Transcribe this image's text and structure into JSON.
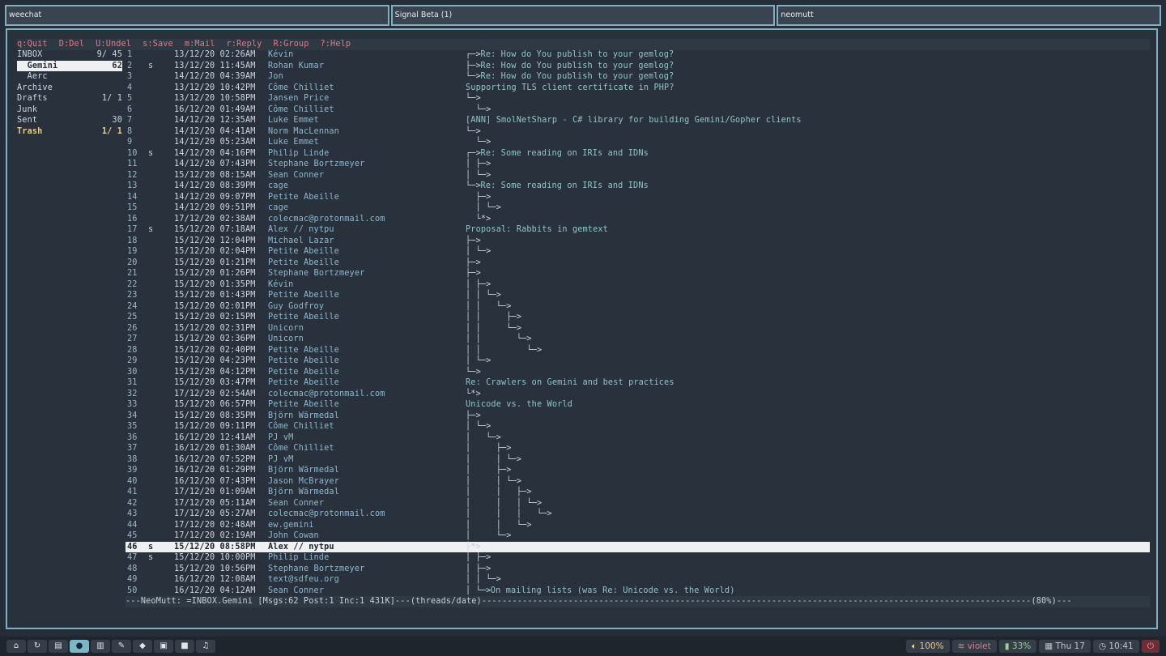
{
  "workspaces": [
    "weechat",
    "Signal Beta (1)",
    "neomutt"
  ],
  "help": [
    "q:Quit",
    "D:Del",
    "U:Undel",
    "s:Save",
    "m:Mail",
    "r:Reply",
    "R:Group",
    "?:Help"
  ],
  "sidebar": [
    {
      "name": "INBOX",
      "count": "9/ 45",
      "state": ""
    },
    {
      "name": "  Gemini",
      "count": "62",
      "state": "sel"
    },
    {
      "name": "  Aerc",
      "count": "",
      "state": ""
    },
    {
      "name": "Archive",
      "count": "",
      "state": ""
    },
    {
      "name": "Drafts",
      "count": "1/ 1",
      "state": ""
    },
    {
      "name": "Junk",
      "count": "",
      "state": ""
    },
    {
      "name": "Sent",
      "count": "30",
      "state": ""
    },
    {
      "name": "Trash",
      "count": "1/ 1",
      "state": "trash"
    }
  ],
  "messages": [
    {
      "num": "1",
      "flag": "",
      "date": "13/12/20 02:26AM",
      "from": "Kévin",
      "tree": "┌─>",
      "subject": "Re: How do You publish to your gemlog?"
    },
    {
      "num": "2",
      "flag": "s",
      "date": "13/12/20 11:45AM",
      "from": "Rohan Kumar",
      "tree": "├─>",
      "subject": "Re: How do You publish to your gemlog?"
    },
    {
      "num": "3",
      "flag": "",
      "date": "14/12/20 04:39AM",
      "from": "Jon",
      "tree": "└─>",
      "subject": "Re: How do You publish to your gemlog?"
    },
    {
      "num": "4",
      "flag": "",
      "date": "13/12/20 10:42PM",
      "from": "Côme Chilliet",
      "tree": "",
      "subject": "Supporting TLS client certificate in PHP?"
    },
    {
      "num": "5",
      "flag": "",
      "date": "13/12/20 10:58PM",
      "from": "Jansen Price",
      "tree": "└─>",
      "subject": ""
    },
    {
      "num": "6",
      "flag": "",
      "date": "16/12/20 01:49AM",
      "from": "Côme Chilliet",
      "tree": "  └─>",
      "subject": ""
    },
    {
      "num": "7",
      "flag": "",
      "date": "14/12/20 12:35AM",
      "from": "Luke Emmet",
      "tree": "",
      "subject": "[ANN] SmolNetSharp - C# library for building Gemini/Gopher clients"
    },
    {
      "num": "8",
      "flag": "",
      "date": "14/12/20 04:41AM",
      "from": "Norm MacLennan",
      "tree": "└─>",
      "subject": ""
    },
    {
      "num": "9",
      "flag": "",
      "date": "14/12/20 05:23AM",
      "from": "Luke Emmet",
      "tree": "  └─>",
      "subject": ""
    },
    {
      "num": "10",
      "flag": "s",
      "date": "14/12/20 04:16PM",
      "from": "Philip Linde",
      "tree": "┌─>",
      "subject": "Re: Some reading on IRIs and IDNs"
    },
    {
      "num": "11",
      "flag": "",
      "date": "14/12/20 07:43PM",
      "from": "Stephane Bortzmeyer",
      "tree": "│ ├─>",
      "subject": ""
    },
    {
      "num": "12",
      "flag": "",
      "date": "15/12/20 08:15AM",
      "from": "Sean Conner",
      "tree": "│ └─>",
      "subject": ""
    },
    {
      "num": "13",
      "flag": "",
      "date": "14/12/20 08:39PM",
      "from": "cage",
      "tree": "└─>",
      "subject": "Re: Some reading on IRIs and IDNs"
    },
    {
      "num": "14",
      "flag": "",
      "date": "14/12/20 09:07PM",
      "from": "Petite Abeille",
      "tree": "  ├─>",
      "subject": ""
    },
    {
      "num": "15",
      "flag": "",
      "date": "14/12/20 09:51PM",
      "from": "cage",
      "tree": "  │ └─>",
      "subject": ""
    },
    {
      "num": "16",
      "flag": "",
      "date": "17/12/20 02:38AM",
      "from": "colecmac@protonmail.com",
      "tree": "  └*>",
      "subject": ""
    },
    {
      "num": "17",
      "flag": "s",
      "date": "15/12/20 07:18AM",
      "from": "Alex // nytpu",
      "tree": "",
      "subject": "Proposal: Rabbits in gemtext"
    },
    {
      "num": "18",
      "flag": "",
      "date": "15/12/20 12:04PM",
      "from": "Michael Lazar",
      "tree": "├─>",
      "subject": ""
    },
    {
      "num": "19",
      "flag": "",
      "date": "15/12/20 02:04PM",
      "from": "Petite Abeille",
      "tree": "│ └─>",
      "subject": ""
    },
    {
      "num": "20",
      "flag": "",
      "date": "15/12/20 01:21PM",
      "from": "Petite Abeille",
      "tree": "├─>",
      "subject": ""
    },
    {
      "num": "21",
      "flag": "",
      "date": "15/12/20 01:26PM",
      "from": "Stephane Bortzmeyer",
      "tree": "├─>",
      "subject": ""
    },
    {
      "num": "22",
      "flag": "",
      "date": "15/12/20 01:35PM",
      "from": "Kévin",
      "tree": "│ ├─>",
      "subject": ""
    },
    {
      "num": "23",
      "flag": "",
      "date": "15/12/20 01:43PM",
      "from": "Petite Abeille",
      "tree": "│ │ └─>",
      "subject": ""
    },
    {
      "num": "24",
      "flag": "",
      "date": "15/12/20 02:01PM",
      "from": "Guy Godfroy",
      "tree": "│ │   └─>",
      "subject": ""
    },
    {
      "num": "25",
      "flag": "",
      "date": "15/12/20 02:15PM",
      "from": "Petite Abeille",
      "tree": "│ │     ├─>",
      "subject": ""
    },
    {
      "num": "26",
      "flag": "",
      "date": "15/12/20 02:31PM",
      "from": "Unicorn",
      "tree": "│ │     └─>",
      "subject": ""
    },
    {
      "num": "27",
      "flag": "",
      "date": "15/12/20 02:36PM",
      "from": "Unicorn",
      "tree": "│ │       └─>",
      "subject": ""
    },
    {
      "num": "28",
      "flag": "",
      "date": "15/12/20 02:40PM",
      "from": "Petite Abeille",
      "tree": "│ │         └─>",
      "subject": ""
    },
    {
      "num": "29",
      "flag": "",
      "date": "15/12/20 04:23PM",
      "from": "Petite Abeille",
      "tree": "│ └─>",
      "subject": ""
    },
    {
      "num": "30",
      "flag": "",
      "date": "15/12/20 04:12PM",
      "from": "Petite Abeille",
      "tree": "└─>",
      "subject": ""
    },
    {
      "num": "31",
      "flag": "",
      "date": "15/12/20 03:47PM",
      "from": "Petite Abeille",
      "tree": "",
      "subject": "Re: Crawlers on Gemini and best practices"
    },
    {
      "num": "32",
      "flag": "",
      "date": "17/12/20 02:54AM",
      "from": "colecmac@protonmail.com",
      "tree": "└*>",
      "subject": ""
    },
    {
      "num": "33",
      "flag": "",
      "date": "15/12/20 06:57PM",
      "from": "Petite Abeille",
      "tree": "",
      "subject": "Unicode vs. the World"
    },
    {
      "num": "34",
      "flag": "",
      "date": "15/12/20 08:35PM",
      "from": "Björn Wärmedal",
      "tree": "├─>",
      "subject": ""
    },
    {
      "num": "35",
      "flag": "",
      "date": "15/12/20 09:11PM",
      "from": "Côme Chilliet",
      "tree": "│ └─>",
      "subject": ""
    },
    {
      "num": "36",
      "flag": "",
      "date": "16/12/20 12:41AM",
      "from": "PJ vM",
      "tree": "│   └─>",
      "subject": ""
    },
    {
      "num": "37",
      "flag": "",
      "date": "16/12/20 01:30AM",
      "from": "Côme Chilliet",
      "tree": "│     ├─>",
      "subject": ""
    },
    {
      "num": "38",
      "flag": "",
      "date": "16/12/20 07:52PM",
      "from": "PJ vM",
      "tree": "│     │ └─>",
      "subject": ""
    },
    {
      "num": "39",
      "flag": "",
      "date": "16/12/20 01:29PM",
      "from": "Björn Wärmedal",
      "tree": "│     ├─>",
      "subject": ""
    },
    {
      "num": "40",
      "flag": "",
      "date": "16/12/20 07:43PM",
      "from": "Jason McBrayer",
      "tree": "│     │ └─>",
      "subject": ""
    },
    {
      "num": "41",
      "flag": "",
      "date": "17/12/20 01:09AM",
      "from": "Björn Wärmedal",
      "tree": "│     │   ├─>",
      "subject": ""
    },
    {
      "num": "42",
      "flag": "",
      "date": "17/12/20 05:11AM",
      "from": "Sean Conner",
      "tree": "│     │   │ └─>",
      "subject": ""
    },
    {
      "num": "43",
      "flag": "",
      "date": "17/12/20 05:27AM",
      "from": "colecmac@protonmail.com",
      "tree": "│     │   │   └─>",
      "subject": ""
    },
    {
      "num": "44",
      "flag": "",
      "date": "17/12/20 02:48AM",
      "from": "ew.gemini",
      "tree": "│     │   └─>",
      "subject": ""
    },
    {
      "num": "45",
      "flag": "",
      "date": "17/12/20 02:19AM",
      "from": "John Cowan",
      "tree": "│     └─>",
      "subject": ""
    },
    {
      "num": "46",
      "flag": "s",
      "date": "15/12/20 08:58PM",
      "from": "Alex // nytpu",
      "tree": "├*>",
      "subject": "",
      "selected": true
    },
    {
      "num": "47",
      "flag": "s",
      "date": "15/12/20 10:00PM",
      "from": "Philip Linde",
      "tree": "│ ├─>",
      "subject": ""
    },
    {
      "num": "48",
      "flag": "",
      "date": "15/12/20 10:56PM",
      "from": "Stephane Bortzmeyer",
      "tree": "│ ├─>",
      "subject": ""
    },
    {
      "num": "49",
      "flag": "",
      "date": "16/12/20 12:08AM",
      "from": "text@sdfeu.org",
      "tree": "│ │ └─>",
      "subject": ""
    },
    {
      "num": "50",
      "flag": "",
      "date": "16/12/20 04:12AM",
      "from": "Sean Conner",
      "tree": "│ └─>",
      "subject": "On mailing lists (was Re: Unicode vs. the World)"
    }
  ],
  "status": "---NeoMutt: =INBOX.Gemini [Msgs:62 Post:1 Inc:1 431K]---(threads/date)------------------------------------------------------------------------------------------------------------(80%)---",
  "taskbar": {
    "launchers": [
      {
        "icon": "home-icon",
        "glyph": "⌂"
      },
      {
        "icon": "refresh-icon",
        "glyph": "↻"
      },
      {
        "icon": "clipboard-icon",
        "glyph": "▤"
      },
      {
        "icon": "chat-icon",
        "glyph": "●",
        "active": true
      },
      {
        "icon": "book-icon",
        "glyph": "▥"
      },
      {
        "icon": "edit-icon",
        "glyph": "✎"
      },
      {
        "icon": "git-icon",
        "glyph": "◆"
      },
      {
        "icon": "windows-icon",
        "glyph": "▣"
      },
      {
        "icon": "camera-icon",
        "glyph": "■"
      },
      {
        "icon": "music-icon",
        "glyph": "♫"
      }
    ],
    "volume": "100%",
    "wifi": "violet",
    "battery": "33%",
    "date": "Thu 17",
    "time": "10:41"
  }
}
